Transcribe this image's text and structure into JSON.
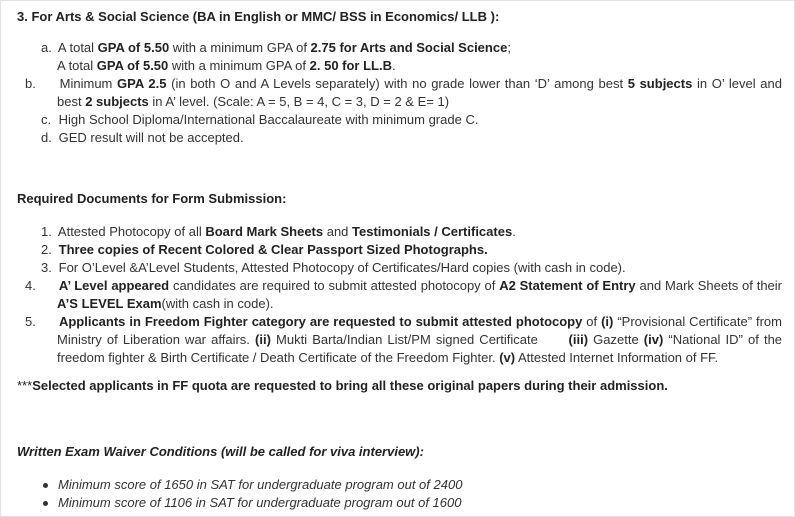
{
  "section3": {
    "title": "3. For Arts & Social Science (BA in English or MMC/ BSS in Economics/ LLB ):",
    "item_a": {
      "marker": "a.",
      "l1_p1": "A total ",
      "l1_b1": "GPA of 5.50",
      "l1_p2": " with a minimum GPA of ",
      "l1_b2": "2.75 for Arts and Social Science",
      "l1_p3": ";",
      "l2_p1": "A total ",
      "l2_b1": "GPA of 5.50",
      "l2_p2": " with a minimum GPA of ",
      "l2_b2": "2. 50 for LL.B",
      "l2_p3": "."
    },
    "item_b": {
      "marker": "b.",
      "p1": "Minimum ",
      "b1": "GPA 2.5",
      "p2": " (in both O and A Levels separately) with no grade lower than ‘D’ among best ",
      "b2": "5 subjects",
      "p3": " in O’ level and best ",
      "b3": "2 subjects",
      "p4": " in A’ level. (Scale: A = 5, B = 4, C = 3, D = 2 & E= 1)"
    },
    "item_c": {
      "marker": "c.",
      "text": "High School Diploma/International Baccalaureate with minimum grade C."
    },
    "item_d": {
      "marker": "d.",
      "text": "GED result will not be accepted."
    }
  },
  "documents": {
    "heading": "Required Documents for Form Submission:",
    "item1": {
      "marker": "1.",
      "p1": "Attested Photocopy of all ",
      "b1": "Board Mark Sheets",
      "p2": " and ",
      "b2": "Testimonials / Certificates",
      "p3": "."
    },
    "item2": {
      "marker": "2.",
      "b1": "Three copies of Recent Colored & Clear Passport Sized Photographs."
    },
    "item3": {
      "marker": "3.",
      "text": "For O’Level &A’Level Students, Attested Photocopy of Certificates/Hard copies (with cash in code)."
    },
    "item4": {
      "marker": "4.",
      "b1": "A’ Level appeared",
      "p1": " candidates are required to submit attested photocopy of ",
      "b2": "A2 Statement of Entry",
      "p2": " and Mark Sheets of their ",
      "b3": "A’S LEVEL Exam",
      "p3": "(with cash in code)."
    },
    "item5": {
      "marker": "5.",
      "b1": "Applicants in Freedom Fighter category  are requested  to submit attested photocopy",
      "p1": " of ",
      "b2": "(i)",
      "p2": " “Provisional Certificate” from Ministry of Liberation war affairs. ",
      "b3": "(ii)",
      "p3": " Mukti Barta/Indian List/PM signed Certificate      ",
      "b4": "(iii)",
      "p4": " Gazette  ",
      "b5": "(iv)",
      "p5": " “National ID” of the freedom fighter & Birth Certificate / Death Certificate of the Freedom Fighter. ",
      "b6": "(v)",
      "p6": " Attested Internet Information of FF."
    }
  },
  "ff_note": {
    "stars": "***",
    "text": "Selected applicants in FF quota are requested to bring all these original papers during their admission."
  },
  "waiver": {
    "heading": "Written Exam Waiver Conditions (will be called for viva interview):",
    "items": [
      "Minimum score of 1650 in SAT for undergraduate program out of 2400",
      "Minimum score of 1106 in SAT for undergraduate program out of 1600"
    ]
  }
}
